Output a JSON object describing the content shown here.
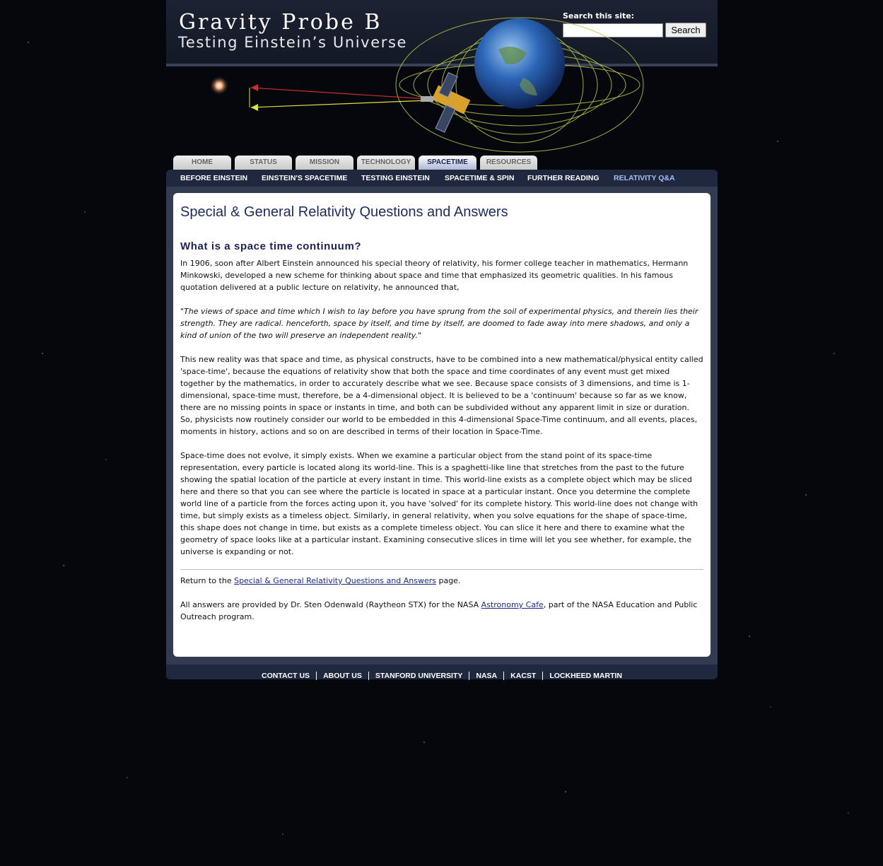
{
  "header": {
    "title": "Gravity Probe B",
    "subtitle": "Testing Einstein’s Universe",
    "search_label": "Search this site:",
    "search_value": "",
    "search_button": "Search"
  },
  "tabs": [
    {
      "label": "HOME"
    },
    {
      "label": "STATUS"
    },
    {
      "label": "MISSION"
    },
    {
      "label": "TECHNOLOGY"
    },
    {
      "label": "SPACETIME",
      "active": true
    },
    {
      "label": "RESOURCES"
    }
  ],
  "subnav": [
    {
      "label": "BEFORE EINSTEIN"
    },
    {
      "label": "EINSTEIN'S SPACETIME"
    },
    {
      "label": "TESTING EINSTEIN"
    },
    {
      "label": "SPACETIME & SPIN"
    },
    {
      "label": "FURTHER READING"
    },
    {
      "label": "RELATIVITY Q&A",
      "active": true
    }
  ],
  "content": {
    "page_title": "Special & General Relativity Questions and Answers",
    "question": "What is a space time continuum?",
    "paragraphs": [
      "In 1906, soon after Albert Einstein announced his special theory of relativity, his former college teacher in mathematics, Hermann Minkowski, developed a new scheme for thinking about space and time that emphasized its geometric qualities. In his famous quotation delivered at a public lecture on relativity, he announced that,",
      "\"The views of space and time which I wish to lay before you have sprung from the soil of experimental physics, and therein lies their strength. They are radical. henceforth, space by itself, and time by itself, are doomed to fade away into mere shadows, and only a kind of union of the two will preserve an independent reality.\"",
      "This new reality was that space and time, as physical constructs, have to be combined into a new mathematical/physical entity called 'space-time', because the equations of relativity show that both the space and time coordinates of any event must get mixed together by the mathematics, in order to accurately describe what we see. Because space consists of 3 dimensions, and time is 1-dimensional, space-time must, therefore, be a 4-dimensional object. It is believed to be a 'continuum' because so far as we know, there are no missing points in space or instants in time, and both can be subdivided without any apparent limit in size or duration. So, physicists now routinely consider our world to be embedded in this 4-dimensional Space-Time continuum, and all events, places, moments in history, actions and so on are described in terms of their location in Space-Time.",
      "Space-time does not evolve, it simply exists. When we examine a particular object from the stand point of its space-time representation, every particle is located along its world-line. This is a spaghetti-like line that stretches from the past to the future showing the spatial location of the particle at every instant in time. This world-line exists as a complete object which may be sliced here and there so that you can see where the particle is located in space at a particular instant. Once you determine the complete world line of a particle from the forces acting upon it, you have 'solved' for its complete history. This world-line does not change with time, but simply exists as a timeless object. Similarly, in general relativity, when you solve equations for the shape of space-time, this shape does not change in time, but exists as a complete timeless object. You can slice it here and there to examine what the geometry of space looks like at a particular instant. Examining consecutive slices in time will let you see whether, for example, the universe is expanding or not."
    ],
    "return_prefix": "Return to the ",
    "return_link": "Special & General Relativity Questions and Answers",
    "return_suffix": " page.",
    "credit_prefix": "All answers are provided by Dr. Sten Odenwald (Raytheon STX) for the NASA ",
    "credit_link": "Astronomy Cafe",
    "credit_suffix": ", part of the NASA Education and Public Outreach program."
  },
  "footer": [
    {
      "label": "CONTACT US"
    },
    {
      "label": "ABOUT US"
    },
    {
      "label": "STANFORD UNIVERSITY"
    },
    {
      "label": "NASA"
    },
    {
      "label": "KACST"
    },
    {
      "label": "LOCKHEED MARTIN"
    }
  ],
  "colors": {
    "nav_bg": "#202840",
    "title": "#1c2a5c",
    "active_subnav": "#a4c0f0"
  }
}
